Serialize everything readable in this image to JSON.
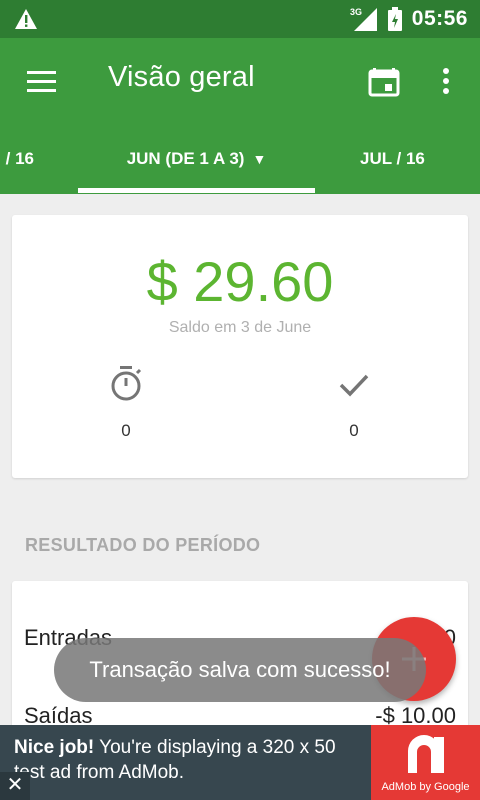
{
  "status_bar": {
    "network": "3G",
    "time": "05:56"
  },
  "app_bar": {
    "title": "Visão geral",
    "color": "#3d9b3e"
  },
  "tabs": [
    {
      "label": "/ 16"
    },
    {
      "label": "JUN (DE 1 A 3)"
    },
    {
      "label": "JUL / 16"
    }
  ],
  "tab_caret": "▼",
  "balance": {
    "amount": "$ 29.60",
    "caption": "Saldo em 3 de June",
    "amount_color": "#5cb531"
  },
  "stats": {
    "pending": {
      "icon": "stopwatch-icon",
      "value": "0"
    },
    "done": {
      "icon": "check-icon",
      "value": "0"
    }
  },
  "section": {
    "title": "RESULTADO DO PERÍODO"
  },
  "results": {
    "income_label": "Entradas",
    "income_value": "$ 39.60",
    "expense_label": "Saídas",
    "expense_value": "-$ 10.00"
  },
  "snackbar": {
    "message": "Transação salva com sucesso!"
  },
  "fab": {
    "icon": "plus-icon",
    "color": "#e53935"
  },
  "ad": {
    "headline": "Nice job!",
    "body": " You're displaying a 320 x 50 test ad from AdMob.",
    "close": "✕",
    "logo_text": "AdMob by Google"
  }
}
